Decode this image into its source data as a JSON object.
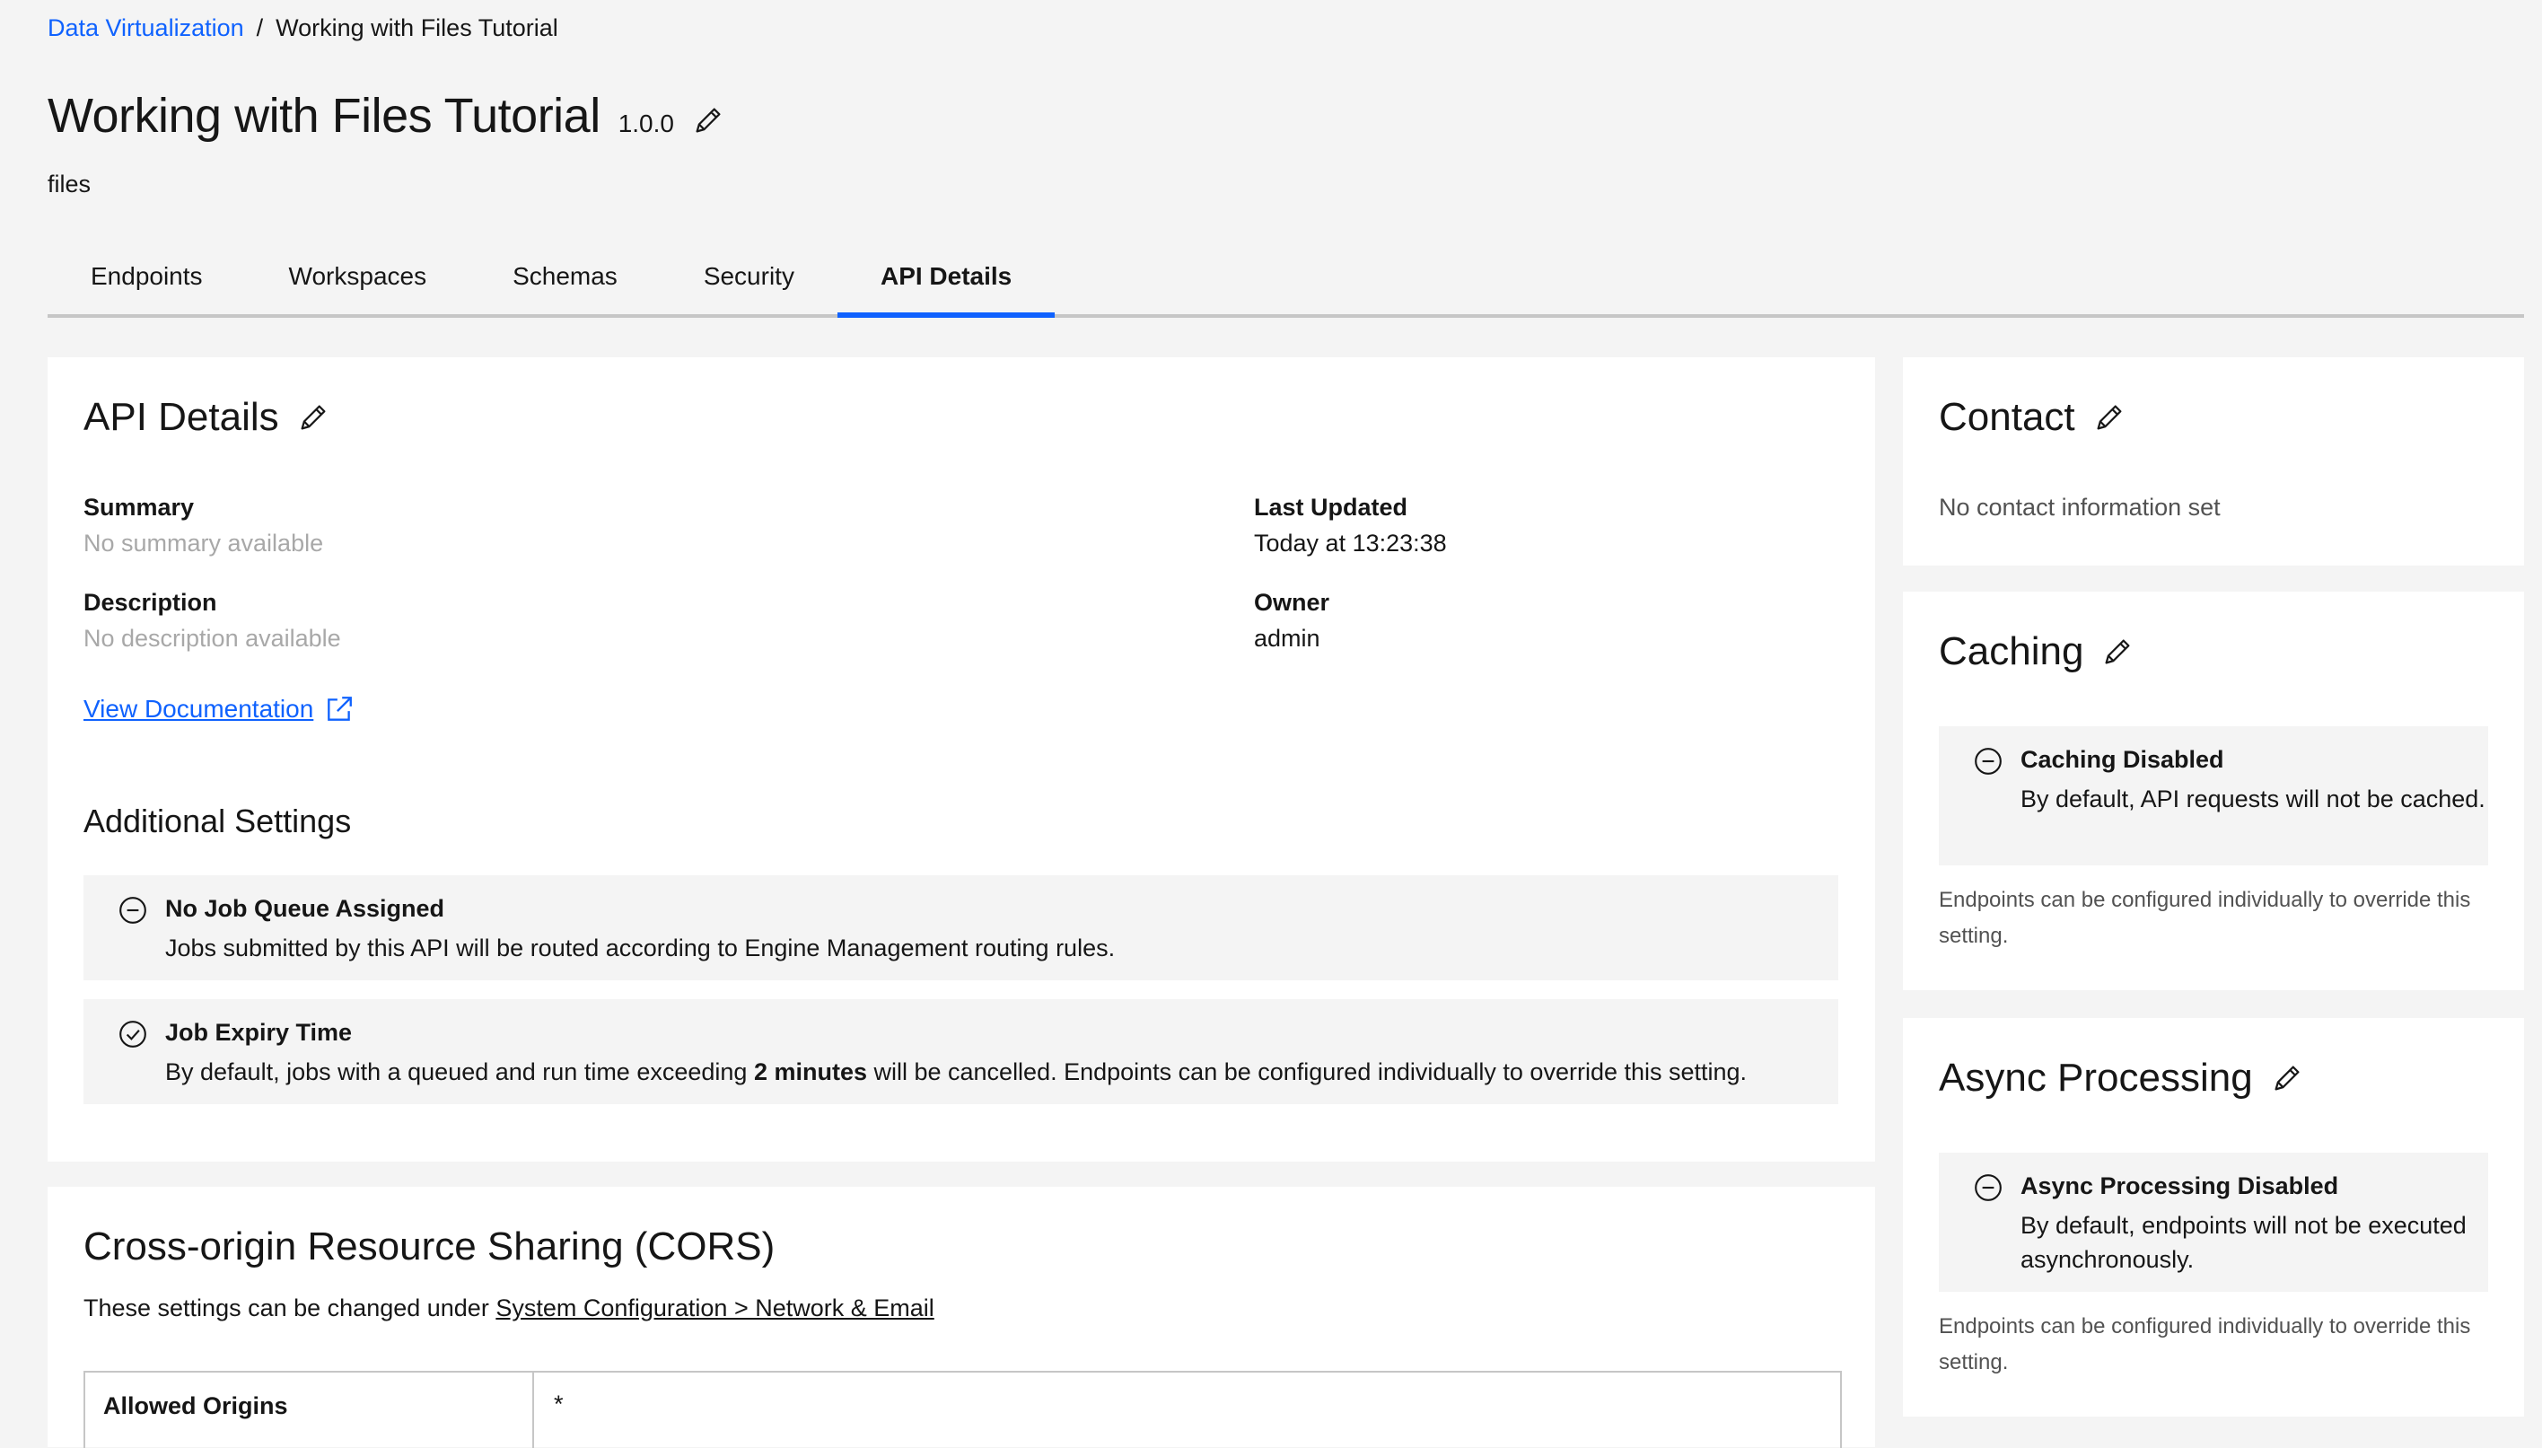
{
  "breadcrumb": {
    "parent": "Data Virtualization",
    "separator": "/",
    "current": "Working with Files Tutorial"
  },
  "header": {
    "title": "Working with Files Tutorial",
    "version": "1.0.0",
    "subtitle": "files"
  },
  "tabs": [
    {
      "label": "Endpoints"
    },
    {
      "label": "Workspaces"
    },
    {
      "label": "Schemas"
    },
    {
      "label": "Security"
    },
    {
      "label": "API Details",
      "active": true
    }
  ],
  "api_details": {
    "title": "API Details",
    "summary_label": "Summary",
    "summary_value": "No summary available",
    "description_label": "Description",
    "description_value": "No description available",
    "last_updated_label": "Last Updated",
    "last_updated_value": "Today at 13:23:38",
    "owner_label": "Owner",
    "owner_value": "admin",
    "doc_link": "View Documentation",
    "additional_heading": "Additional Settings",
    "job_queue": {
      "title": "No Job Queue Assigned",
      "text": "Jobs submitted by this API will be routed according to Engine Management routing rules."
    },
    "job_expiry": {
      "title": "Job Expiry Time",
      "text_before": "By default, jobs with a queued and run time exceeding ",
      "text_bold": "2 minutes",
      "text_after": " will be cancelled. Endpoints can be configured individually to override this setting."
    }
  },
  "cors": {
    "title": "Cross-origin Resource Sharing (CORS)",
    "desc": "These settings can be changed under ",
    "link": "System Configuration > Network & Email",
    "table_header": "Allowed Origins",
    "table_value": "*"
  },
  "contact": {
    "title": "Contact",
    "text": "No contact information set"
  },
  "caching": {
    "title": "Caching",
    "notice_title": "Caching Disabled",
    "notice_text": "By default, API requests will not be cached.",
    "footnote": "Endpoints can be configured individually to override this setting."
  },
  "async": {
    "title": "Async Processing",
    "notice_title": "Async Processing Disabled",
    "notice_text": "By default, endpoints will not be executed asynchronously.",
    "footnote": "Endpoints can be configured individually to override this setting."
  },
  "colors": {
    "link": "#0f62fe",
    "tab_active": "#0f62fe",
    "background": "#f4f4f4",
    "card": "#ffffff"
  },
  "icons": [
    "edit-pencil-icon",
    "external-link-icon",
    "minus-circle-icon",
    "checkmark-circle-icon"
  ]
}
